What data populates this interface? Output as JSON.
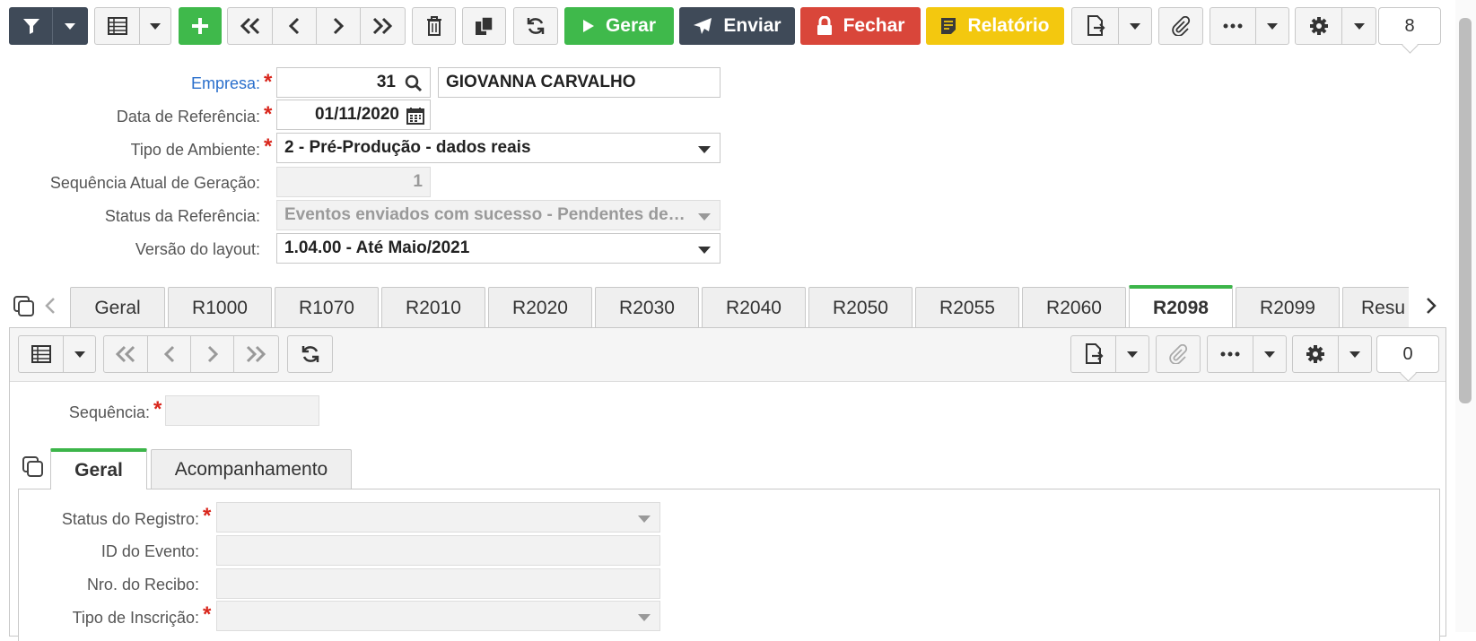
{
  "toolbar": {
    "gerar_label": "Gerar",
    "enviar_label": "Enviar",
    "fechar_label": "Fechar",
    "relatorio_label": "Relatório",
    "counter": "8"
  },
  "form": {
    "empresa_label": "Empresa:",
    "empresa_code": "31",
    "empresa_name": "GIOVANNA CARVALHO",
    "data_label": "Data de Referência:",
    "data_value": "01/11/2020",
    "ambiente_label": "Tipo de Ambiente:",
    "ambiente_value": "2 - Pré-Produção - dados reais",
    "sequencia_geracao_label": "Sequência Atual de Geração:",
    "sequencia_geracao_value": "1",
    "status_ref_label": "Status da Referência:",
    "status_ref_value": "Eventos enviados com sucesso - Pendentes de…",
    "versao_label": "Versão do layout:",
    "versao_value": "1.04.00 - Até Maio/2021"
  },
  "tabs": [
    "Geral",
    "R1000",
    "R1070",
    "R2010",
    "R2020",
    "R2030",
    "R2040",
    "R2050",
    "R2055",
    "R2060",
    "R2098",
    "R2099",
    "Resu"
  ],
  "active_tab": "R2098",
  "subtoolbar": {
    "counter": "0"
  },
  "detail": {
    "sequencia_label": "Sequência:",
    "sequencia_value": "",
    "inner_tabs": [
      "Geral",
      "Acompanhamento"
    ],
    "active_inner_tab": "Geral",
    "status_registro_label": "Status do Registro:",
    "id_evento_label": "ID do Evento:",
    "nro_recibo_label": "Nro. do Recibo:",
    "tipo_inscricao_label": "Tipo de Inscrição:"
  },
  "colors": {
    "gerar": "#3fb94b",
    "enviar": "#3f4a58",
    "fechar": "#d9463a",
    "relatorio": "#f3c80f",
    "add": "#3fb94b",
    "active_tab_accent": "#3cb54a"
  }
}
